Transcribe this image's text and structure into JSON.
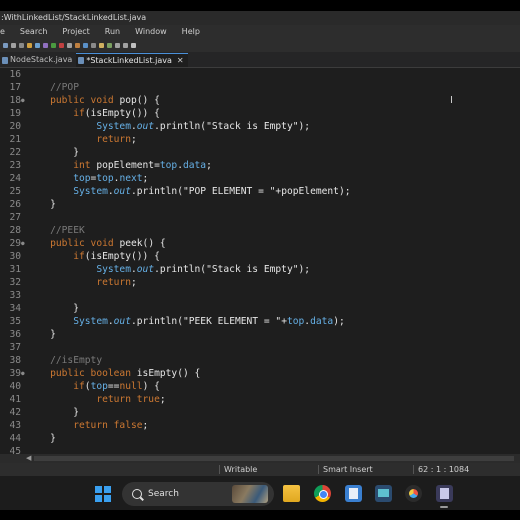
{
  "window": {
    "title": ":WithLinkedList/StackLinkedList.java"
  },
  "menu": [
    "e",
    "Search",
    "Project",
    "Run",
    "Window",
    "Help"
  ],
  "tabs": [
    {
      "label": "NodeStack.java",
      "active": false
    },
    {
      "label": "*StackLinkedList.java",
      "active": true,
      "close": "✕"
    }
  ],
  "code": {
    "lines": [
      {
        "n": "16",
        "t": ""
      },
      {
        "n": "17",
        "t": "    //POP"
      },
      {
        "n": "18",
        "t": "    public void pop() {",
        "marker": true
      },
      {
        "n": "19",
        "t": "        if(isEmpty()) {"
      },
      {
        "n": "20",
        "t": "            System.out.println(\"Stack is Empty\");"
      },
      {
        "n": "21",
        "t": "            return;"
      },
      {
        "n": "22",
        "t": "        }"
      },
      {
        "n": "23",
        "t": "        int popElement=top.data;"
      },
      {
        "n": "24",
        "t": "        top=top.next;"
      },
      {
        "n": "25",
        "t": "        System.out.println(\"POP ELEMENT = \"+popElement);"
      },
      {
        "n": "26",
        "t": "    }"
      },
      {
        "n": "27",
        "t": ""
      },
      {
        "n": "28",
        "t": "    //PEEK"
      },
      {
        "n": "29",
        "t": "    public void peek() {",
        "marker": true
      },
      {
        "n": "30",
        "t": "        if(isEmpty()) {"
      },
      {
        "n": "31",
        "t": "            System.out.println(\"Stack is Empty\");"
      },
      {
        "n": "32",
        "t": "            return;"
      },
      {
        "n": "33",
        "t": ""
      },
      {
        "n": "34",
        "t": "        }"
      },
      {
        "n": "35",
        "t": "        System.out.println(\"PEEK ELEMENT = \"+top.data);"
      },
      {
        "n": "36",
        "t": "    }"
      },
      {
        "n": "37",
        "t": ""
      },
      {
        "n": "38",
        "t": "    //isEmpty"
      },
      {
        "n": "39",
        "t": "    public boolean isEmpty() {",
        "marker": true
      },
      {
        "n": "40",
        "t": "        if(top==null) {"
      },
      {
        "n": "41",
        "t": "            return true;"
      },
      {
        "n": "42",
        "t": "        }"
      },
      {
        "n": "43",
        "t": "        return false;"
      },
      {
        "n": "44",
        "t": "    }"
      },
      {
        "n": "45",
        "t": ""
      }
    ]
  },
  "status": {
    "mode": "Writable",
    "insert": "Smart Insert",
    "position": "62 : 1 : 1084"
  },
  "taskbar": {
    "search_label": "Search",
    "apps": [
      "start-icon",
      "file-explorer-icon",
      "chrome-icon",
      "notepad-icon",
      "whiteboard-icon",
      "davinci-resolve-icon",
      "eclipse-icon"
    ]
  },
  "colors": {
    "keyword": "#cc7832",
    "comment": "#7a7a7a",
    "field": "#66b0e6",
    "text": "#e6e6e6",
    "editor_bg": "#1e1e1e"
  }
}
